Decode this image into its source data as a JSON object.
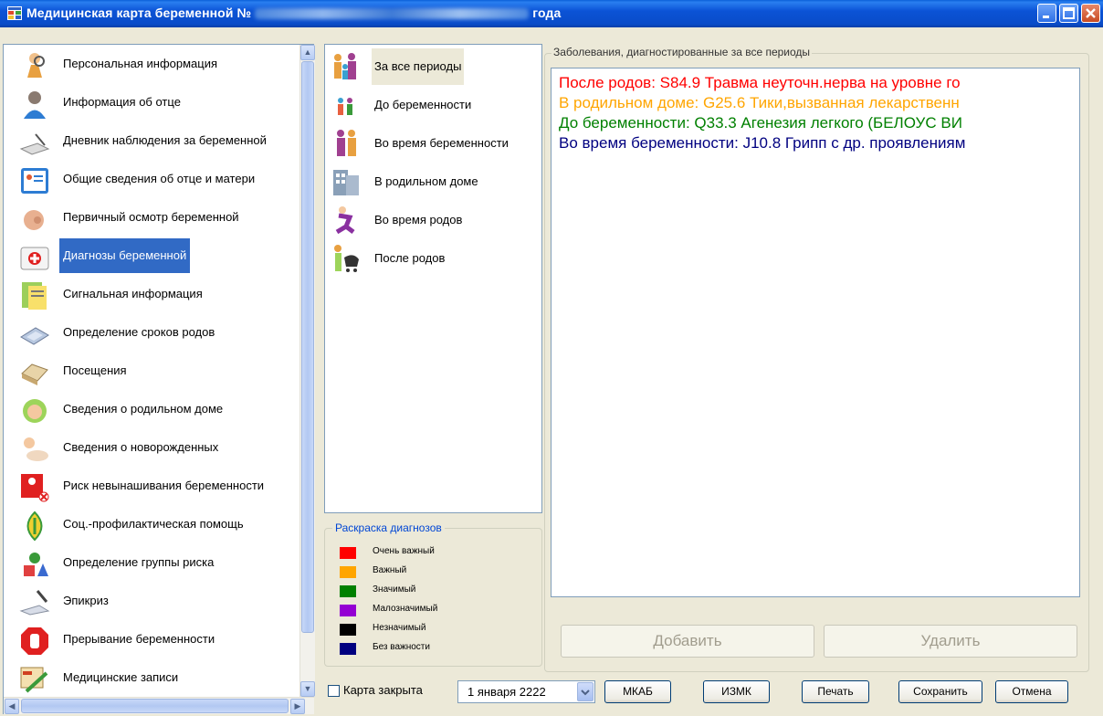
{
  "window": {
    "title_prefix": "Медицинская карта беременной №",
    "title_suffix": "года"
  },
  "nav": {
    "items": [
      {
        "label": "Персональная информация",
        "icon": "person-icon"
      },
      {
        "label": "Информация об отце",
        "icon": "father-icon"
      },
      {
        "label": "Дневник наблюдения за беременной",
        "icon": "diary-icon"
      },
      {
        "label": "Общие сведения об отце и матери",
        "icon": "contact-card-icon"
      },
      {
        "label": "Первичный осмотр беременной",
        "icon": "pregnant-belly-icon"
      },
      {
        "label": "Диагнозы беременной",
        "icon": "medical-kit-icon",
        "selected": true
      },
      {
        "label": "Сигнальная информация",
        "icon": "notes-icon"
      },
      {
        "label": "Определение сроков родов",
        "icon": "calculator-icon"
      },
      {
        "label": "Посещения",
        "icon": "card-index-icon"
      },
      {
        "label": "Сведения о родильном доме",
        "icon": "baby-face-icon"
      },
      {
        "label": "Сведения о новорожденных",
        "icon": "newborn-icon"
      },
      {
        "label": "Риск невынашивания беременности",
        "icon": "risk-icon"
      },
      {
        "label": "Соц.-профилактическая помощь",
        "icon": "social-help-icon"
      },
      {
        "label": "Определение группы риска",
        "icon": "risk-group-icon"
      },
      {
        "label": "Эпикриз",
        "icon": "pen-icon"
      },
      {
        "label": "Прерывание беременности",
        "icon": "stop-hand-icon"
      },
      {
        "label": "Медицинские записи",
        "icon": "medical-records-icon"
      }
    ]
  },
  "periods": {
    "items": [
      {
        "label": "За все периоды",
        "icon": "family-icon",
        "selected": true
      },
      {
        "label": "До беременности",
        "icon": "couple-icon"
      },
      {
        "label": "Во время беременности",
        "icon": "pregnant-couple-icon"
      },
      {
        "label": "В родильном доме",
        "icon": "hospital-building-icon"
      },
      {
        "label": "Во время родов",
        "icon": "running-woman-icon"
      },
      {
        "label": "После родов",
        "icon": "mother-stroller-icon"
      }
    ]
  },
  "legend": {
    "title": "Раскраска диагнозов",
    "items": [
      {
        "label": "Очень важный",
        "color": "#ff0000"
      },
      {
        "label": "Важный",
        "color": "#ffa500"
      },
      {
        "label": "Значимый",
        "color": "#008000"
      },
      {
        "label": "Малозначимый",
        "color": "#9400d3"
      },
      {
        "label": "Незначимый",
        "color": "#000000"
      },
      {
        "label": "Без важности",
        "color": "#000080"
      }
    ]
  },
  "diagnoses": {
    "title": "Заболевания, диагностированные за все периоды",
    "lines": [
      {
        "text": "После родов: S84.9 Травма неуточн.нерва на уровне го",
        "color": "#ff0000"
      },
      {
        "text": "В родильном доме: G25.6 Тики,вызванная лекарственн",
        "color": "#ffa500"
      },
      {
        "text": "До беременности: Q33.3 Агенезия легкого (БЕЛОУС ВИ",
        "color": "#008000"
      },
      {
        "text": "Во время беременности: J10.8 Грипп с др. проявлениям",
        "color": "#000080"
      }
    ],
    "add_label": "Добавить",
    "delete_label": "Удалить"
  },
  "footer": {
    "closed_label": "Карта закрыта",
    "date_value": "1  января  2222",
    "buttons": [
      "МКАБ",
      "ИЗМК",
      "Печать",
      "Сохранить",
      "Отмена"
    ]
  }
}
